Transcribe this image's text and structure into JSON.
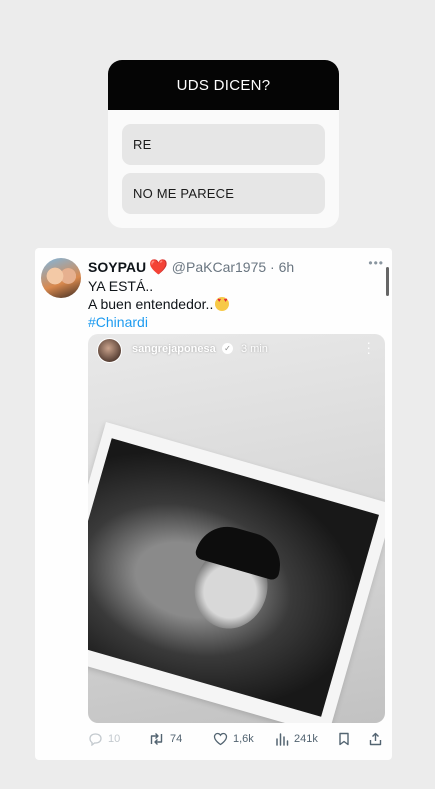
{
  "poll": {
    "question": "UDS DICEN?",
    "options": [
      "RE",
      "NO ME PARECE"
    ]
  },
  "tweet": {
    "display_name": "SOYPAU",
    "heart": "❤️",
    "handle": "@PaKCar1975 · 6h",
    "lines": [
      "YA ESTÁ..",
      "A buen entendedor..",
      "#Chinardi"
    ],
    "more": "•••"
  },
  "story": {
    "username": "sangrejaponesa",
    "time": "3 min"
  },
  "actions": {
    "replies": "10",
    "retweets": "74",
    "likes": "1,6k",
    "views": "241k"
  },
  "icons": [
    "heart-emoji-icon",
    "heart-eyes-emoji-icon",
    "verified-icon",
    "kebab-menu-icon",
    "reply-icon",
    "retweet-icon",
    "like-icon",
    "views-icon",
    "bookmark-icon",
    "share-icon"
  ],
  "colors": {
    "poll_header": "#050505",
    "hashtag": "#1d9bf0",
    "heart": "#e0102a",
    "muted_text": "#536471"
  }
}
